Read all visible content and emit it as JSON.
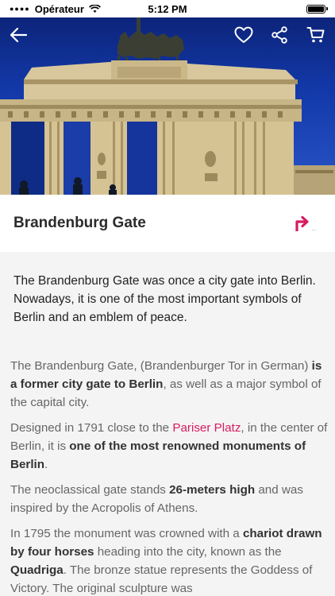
{
  "status_bar": {
    "carrier": "Opérateur",
    "time": "5:12 PM"
  },
  "hero": {
    "subject": "Brandenburg Gate photo at dusk"
  },
  "nav": {
    "back_icon": "arrow-left-icon",
    "favorite_icon": "heart-icon",
    "share_icon": "share-icon",
    "cart_icon": "cart-icon"
  },
  "place": {
    "title": "Brandenburg Gate",
    "directions_icon": "turn-right-arrow-icon",
    "directions_small": "..."
  },
  "summary": "The Brandenburg Gate was once a city gate into Berlin. Nowadays, it is one of the most important symbols of Berlin and an emblem of peace.",
  "article": {
    "p1_a": "The Brandenburg Gate, (Brandenburger Tor in German) ",
    "p1_b": "is a former city gate to Berlin",
    "p1_c": ", as well as a major symbol of the capital city.",
    "p2_a": "Designed in 1791 close to the ",
    "p2_link": "Pariser Platz",
    "p2_b": ", in the center of Berlin, it is ",
    "p2_c": "one of the most renowned monuments of Berlin",
    "p2_d": ".",
    "p3_a": "The neoclassical gate stands ",
    "p3_b": "26-meters high",
    "p3_c": " and was inspired by the Acropolis of Athens.",
    "p4_a": "In 1795 the monument was crowned with a ",
    "p4_b": "chariot drawn by four horses",
    "p4_c": " heading into the city, known as the ",
    "p4_d": "Quadriga",
    "p4_e": ". The bronze statue represents the Goddess of Victory. The original sculpture was"
  },
  "colors": {
    "accent": "#d81b60",
    "sky": "#1238a8",
    "stone": "#c9b48a"
  }
}
